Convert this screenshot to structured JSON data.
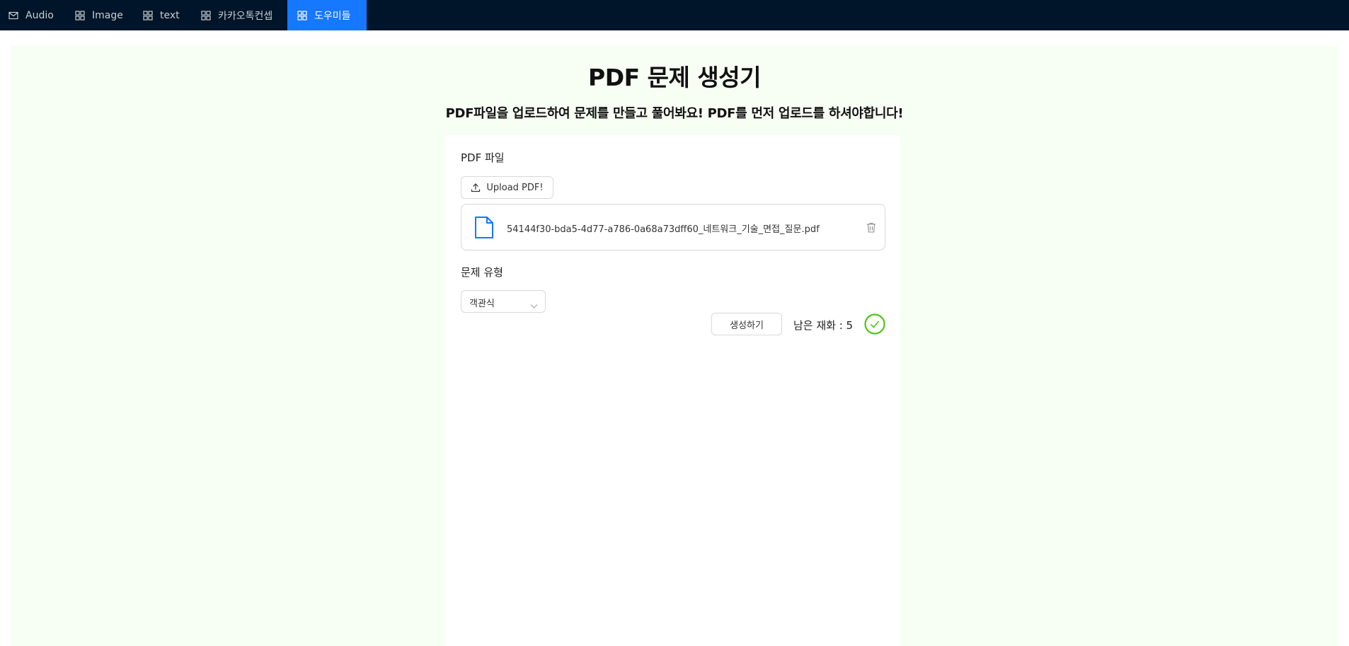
{
  "nav": {
    "items": [
      {
        "label": "Audio",
        "icon": "mail-icon"
      },
      {
        "label": "Image",
        "icon": "appstore-icon"
      },
      {
        "label": "text",
        "icon": "appstore-icon"
      },
      {
        "label": "카카오톡컨셉",
        "icon": "appstore-icon"
      },
      {
        "label": "도우미들",
        "icon": "appstore-icon",
        "active": true
      }
    ]
  },
  "page": {
    "title": "PDF 문제 생성기",
    "subtitle": "PDF파일을 업로드하여 문제를 만들고 풀어봐요! PDF를 먼저 업로드를 하셔야합니다!"
  },
  "form": {
    "pdf_label": "PDF 파일",
    "upload_label": "Upload PDF!",
    "file_name": "54144f30-bda5-4d77-a786-0a68a73dff60_네트워크_기술_면접_질문.pdf",
    "type_label": "문제 유형",
    "type_value": "객관식",
    "generate_label": "생성하기",
    "remaining_text": "남은 재화 : 5"
  },
  "colors": {
    "nav_bg": "#001529",
    "nav_active": "#1677ff",
    "content_bg": "#f7fff4",
    "success": "#52c41a",
    "file_icon": "#1677ff"
  }
}
